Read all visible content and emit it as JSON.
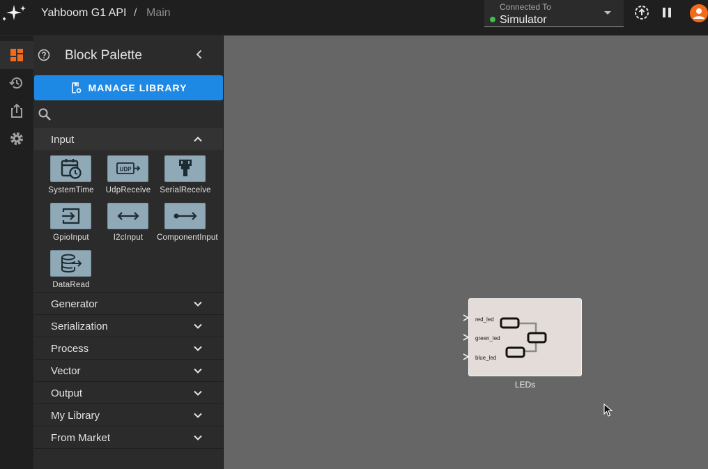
{
  "header": {
    "project": "Yahboom G1 API",
    "separator": "/",
    "page": "Main",
    "connection": {
      "label": "Connected To",
      "value": "Simulator",
      "status_color": "#3fbf4a"
    },
    "icons": [
      "sync-icon",
      "pause-icon",
      "account-icon"
    ]
  },
  "rail": {
    "items": [
      {
        "name": "dashboard-icon",
        "active": true
      },
      {
        "name": "history-icon",
        "active": false
      },
      {
        "name": "export-icon",
        "active": false
      },
      {
        "name": "settings-icon",
        "active": false
      }
    ]
  },
  "palette": {
    "title": "Block Palette",
    "manage_label": "MANAGE LIBRARY",
    "search": {
      "value": "",
      "placeholder": ""
    },
    "input_category": "Input",
    "blocks": [
      {
        "label": "SystemTime",
        "icon": "calendar-clock-icon"
      },
      {
        "label": "UdpReceive",
        "icon": "udp-icon"
      },
      {
        "label": "SerialReceive",
        "icon": "serial-connector-icon"
      },
      {
        "label": "GpioInput",
        "icon": "login-box-icon"
      },
      {
        "label": "I2cInput",
        "icon": "left-right-arrow-icon"
      },
      {
        "label": "ComponentInput",
        "icon": "dot-arrow-icon"
      },
      {
        "label": "DataRead",
        "icon": "database-arrow-icon"
      }
    ],
    "categories": [
      "Generator",
      "Serialization",
      "Process",
      "Vector",
      "Output",
      "My Library",
      "From Market"
    ]
  },
  "canvas": {
    "node": {
      "title": "LEDs",
      "inputs": [
        "red_led",
        "green_led",
        "blue_led"
      ],
      "icon": "component-graph-icon"
    }
  },
  "colors": {
    "accent": "#f26b1d",
    "primary_button": "#1e88e5",
    "canvas": "#666666",
    "block_tile": "#90a9b7"
  }
}
